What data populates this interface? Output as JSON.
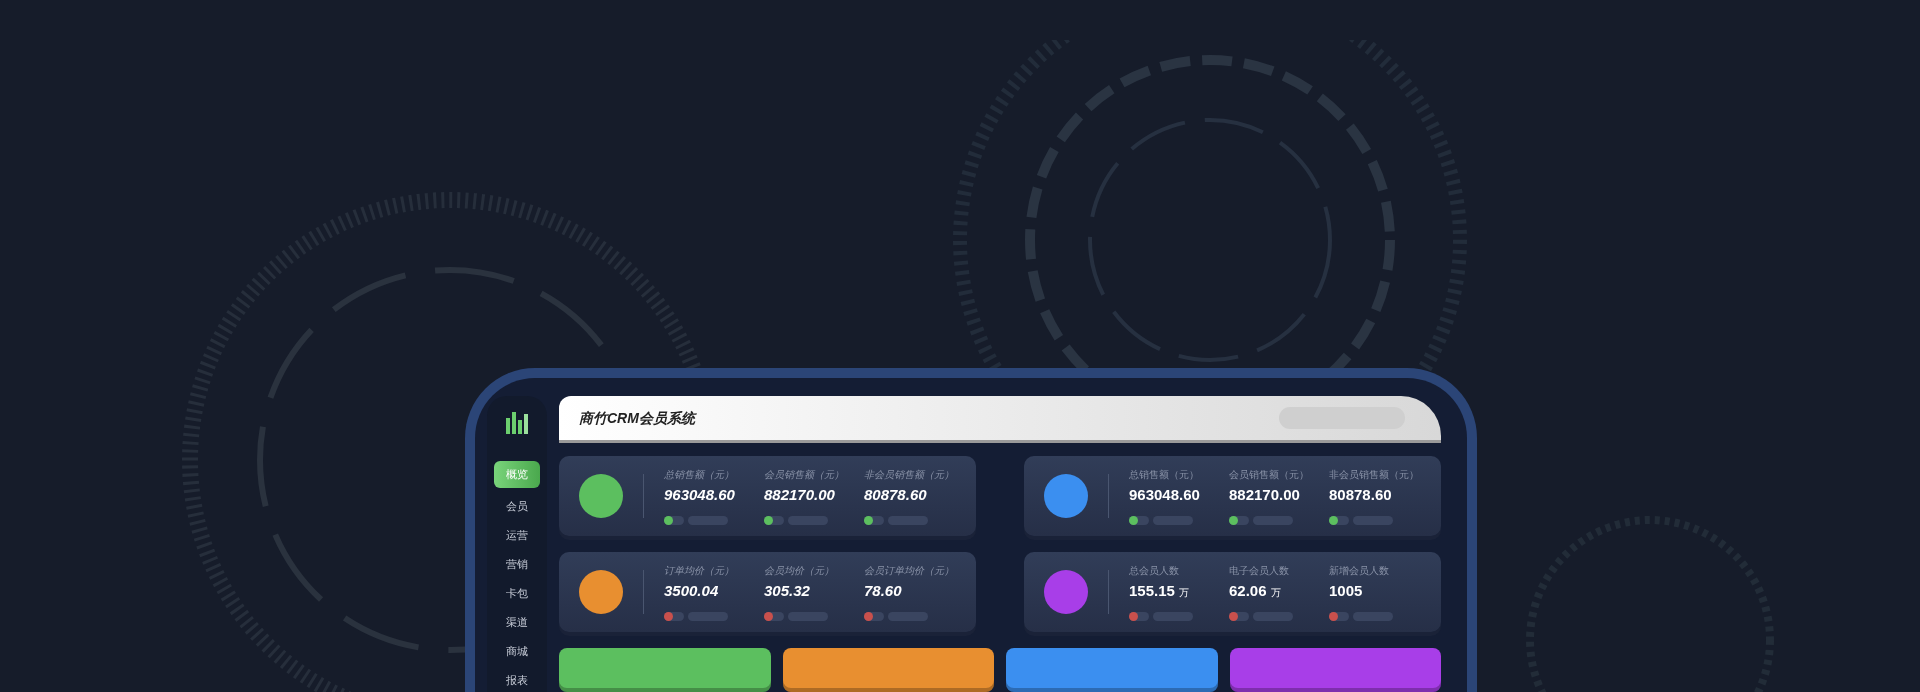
{
  "header": {
    "title": "商竹CRM会员系统"
  },
  "sidebar": {
    "items": [
      {
        "label": "概览",
        "selected": true
      },
      {
        "label": "会员",
        "selected": false
      },
      {
        "label": "运营",
        "selected": false
      },
      {
        "label": "营销",
        "selected": false
      },
      {
        "label": "卡包",
        "selected": false
      },
      {
        "label": "渠道",
        "selected": false
      },
      {
        "label": "商城",
        "selected": false
      },
      {
        "label": "报表",
        "selected": false
      }
    ]
  },
  "cards": [
    {
      "color": "#5cbf5f",
      "italic": true,
      "metrics": [
        {
          "label": "总销售额（元）",
          "value": "963048.60",
          "color": "#5cbf5f"
        },
        {
          "label": "会员销售额（元）",
          "value": "882170.00",
          "color": "#5cbf5f"
        },
        {
          "label": "非会员销售额（元）",
          "value": "80878.60",
          "color": "#5cbf5f"
        }
      ]
    },
    {
      "color": "#3b8ff0",
      "italic": false,
      "metrics": [
        {
          "label": "总销售额（元）",
          "value": "963048.60",
          "color": "#5cbf5f"
        },
        {
          "label": "会员销售额（元）",
          "value": "882170.00",
          "color": "#5cbf5f"
        },
        {
          "label": "非会员销售额（元）",
          "value": "80878.60",
          "color": "#5cbf5f"
        }
      ]
    },
    {
      "color": "#e88f30",
      "italic": true,
      "metrics": [
        {
          "label": "订单均价（元）",
          "value": "3500.04",
          "color": "#c9504c"
        },
        {
          "label": "会员均价（元）",
          "value": "305.32",
          "color": "#c9504c"
        },
        {
          "label": "会员订单均价（元）",
          "value": "78.60",
          "color": "#c9504c"
        }
      ]
    },
    {
      "color": "#a83ee8",
      "italic": false,
      "metrics": [
        {
          "label": "总会员人数",
          "value": "155.15",
          "unit": "万",
          "color": "#c9504c"
        },
        {
          "label": "电子会员人数",
          "value": "62.06",
          "unit": "万",
          "color": "#c9504c"
        },
        {
          "label": "新增会员人数",
          "value": "1005",
          "color": "#c9504c"
        }
      ]
    }
  ],
  "bars": [
    {
      "color": "#5cbf5f"
    },
    {
      "color": "#e88f30"
    },
    {
      "color": "#3b8ff0"
    },
    {
      "color": "#a83ee8"
    }
  ]
}
